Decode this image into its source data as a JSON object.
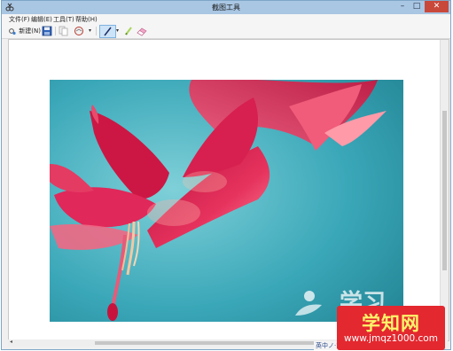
{
  "window": {
    "title": "截图工具",
    "minimize_glyph": "–",
    "maximize_glyph": "□",
    "close_glyph": "✕"
  },
  "menubar": {
    "items": [
      {
        "label": "文件(F)"
      },
      {
        "label": "编辑(E)"
      },
      {
        "label": "工具(T)"
      },
      {
        "label": "帮助(H)"
      }
    ]
  },
  "toolbar": {
    "new_label": "新建(N)",
    "icons": [
      "new-snip-icon",
      "save-icon",
      "copy-icon",
      "send-icon",
      "dropdown-icon",
      "pen-icon",
      "highlighter-icon",
      "eraser-icon"
    ]
  },
  "watermark": {
    "text": "学习",
    "logo_title": "学知网",
    "logo_url": "www.jmqz1000.com"
  },
  "ime_bar": {
    "text": "英中ノ·简"
  },
  "colors": {
    "annotation_arrow": "#b441c7",
    "photo_background": "#3aa7b8",
    "flower": "#d91f4e",
    "logo_background": "#e3282f",
    "logo_title": "#fff46a"
  }
}
